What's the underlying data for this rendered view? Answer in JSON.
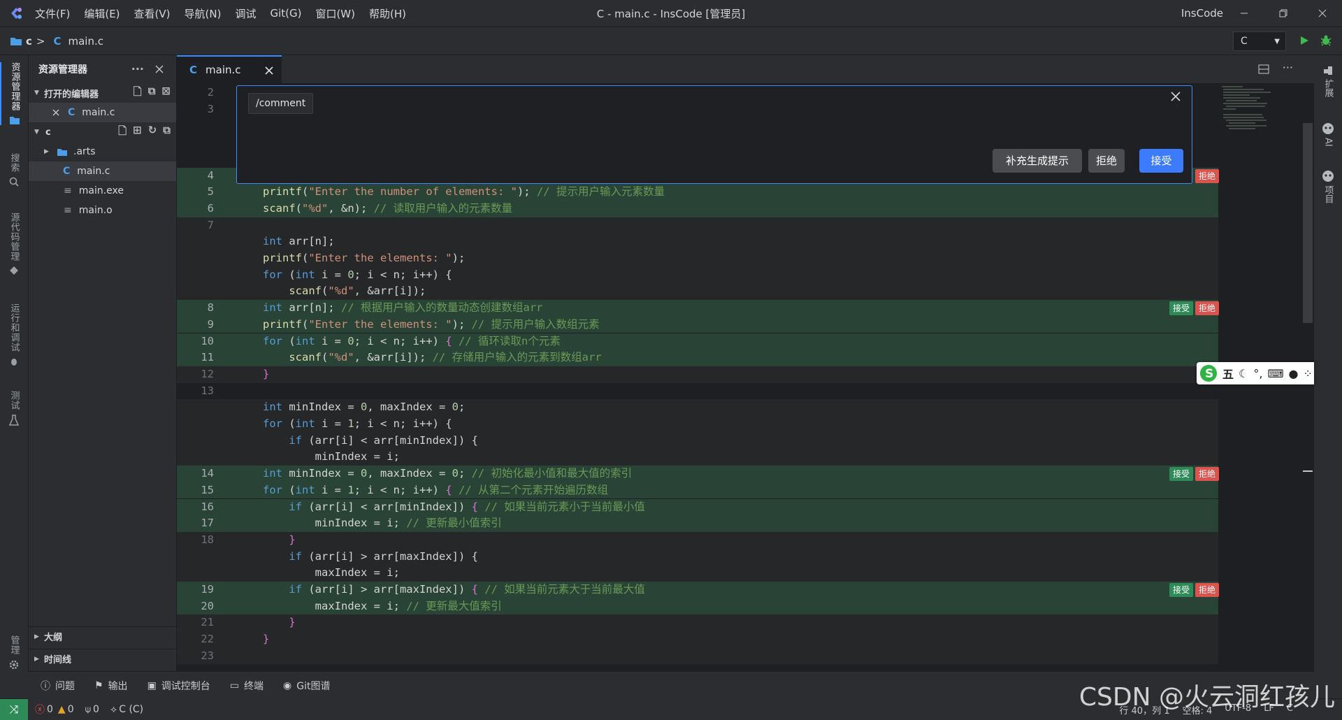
{
  "menu": [
    "文件(F)",
    "编辑(E)",
    "查看(V)",
    "导航(N)",
    "调试",
    "Git(G)",
    "窗口(W)",
    "帮助(H)"
  ],
  "window_title": "C - main.c - InsCode [管理员]",
  "brand": "InsCode",
  "breadcrumb": {
    "folder": "c",
    "sep": ">",
    "file_glyph": "C",
    "file": "main.c"
  },
  "language_select": "C",
  "activity_bar": [
    "资源管理器",
    "搜索",
    "源代码管理",
    "运行和调试",
    "测试",
    "管理"
  ],
  "right_bar": [
    "扩展",
    "AI",
    "项目"
  ],
  "explorer": {
    "title": "资源管理器",
    "open_editors": {
      "label": "打开的编辑器",
      "items": [
        {
          "glyph": "C",
          "name": "main.c"
        }
      ]
    },
    "folder": {
      "label": "c",
      "items": [
        {
          "name": ".arts",
          "type": "folder"
        },
        {
          "name": "main.c",
          "type": "c"
        },
        {
          "name": "main.exe",
          "type": "file"
        },
        {
          "name": "main.o",
          "type": "file"
        }
      ]
    },
    "outline": "大纲",
    "timeline": "时间线"
  },
  "tab": {
    "label": "main.c",
    "glyph": "C"
  },
  "popup": {
    "input": "/comment",
    "btn_supplement": "补充生成提示",
    "btn_reject": "拒绝",
    "btn_accept": "接受"
  },
  "diff_labels": {
    "accept": "接受",
    "reject": "拒绝"
  },
  "ime": {
    "mode": "五"
  },
  "panel_tabs": [
    "问题",
    "输出",
    "调试控制台",
    "终端",
    "Git图谱"
  ],
  "status": {
    "errors": "0",
    "warnings": "0",
    "ports": "0",
    "language": "C (C)",
    "position": "行 40，列 1",
    "spaces": "空格: 4",
    "encoding": "UTF-8",
    "eol": "LF",
    "lang_short": "C"
  },
  "watermark": "CSDN @火云洞红孩儿",
  "code_lines": [
    {
      "n": "2",
      "kind": "plain",
      "html": ""
    },
    {
      "n": "3",
      "kind": "plain",
      "html": ""
    },
    {
      "n": "",
      "kind": "plain",
      "html": ""
    },
    {
      "n": "",
      "kind": "plain",
      "html": ""
    },
    {
      "n": "",
      "kind": "plain",
      "html": ""
    },
    {
      "n": "4",
      "kind": "add",
      "html": "",
      "buttons": "reject"
    },
    {
      "n": "5",
      "kind": "add",
      "html": "<span class='fn'>printf</span><span class='pn'>(</span><span class='str'>\"Enter the number of elements: \"</span><span class='pn'>); </span><span class='cm'>// 提示用户输入元素数量</span>"
    },
    {
      "n": "6",
      "kind": "add",
      "html": "<span class='fn'>scanf</span><span class='pn'>(</span><span class='str'>\"%d\"</span><span class='pn'>, &amp;n); </span><span class='cm'>// 读取用户输入的元素数量</span>"
    },
    {
      "n": "7",
      "kind": "old",
      "html": ""
    },
    {
      "n": "",
      "kind": "old",
      "html": "<span class='kw'>int</span><span class='id'> arr[n];</span>"
    },
    {
      "n": "",
      "kind": "old",
      "html": "<span class='fn'>printf</span><span class='pn'>(</span><span class='str'>\"Enter the elements: \"</span><span class='pn'>);</span>"
    },
    {
      "n": "",
      "kind": "old",
      "html": "<span class='kw'>for</span><span class='pn'> (</span><span class='kw'>int</span><span class='id'> i = </span><span class='num'>0</span><span class='id'>; i &lt; n; i++) {</span>"
    },
    {
      "n": "",
      "kind": "old",
      "html": "    <span class='fn'>scanf</span><span class='pn'>(</span><span class='str'>\"%d\"</span><span class='pn'>, &amp;arr[i]);</span>"
    },
    {
      "n": "8",
      "kind": "add",
      "html": "<span class='kw'>int</span><span class='id'> arr[n]; </span><span class='cm'>// 根据用户输入的数量动态创建数组arr</span>",
      "buttons": "both"
    },
    {
      "n": "9",
      "kind": "add",
      "html": "<span class='fn'>printf</span><span class='pn'>(</span><span class='str'>\"Enter the elements: \"</span><span class='pn'>); </span><span class='cm'>// 提示用户输入数组元素</span>"
    },
    {
      "n": "10",
      "kind": "add",
      "html": "<span class='kw'>for</span><span class='pn'> (</span><span class='kw'>int</span><span class='id'> i = </span><span class='num'>0</span><span class='id'>; i &lt; n; i++) </span><span class='br'>{</span><span class='cm'> // 循环读取n个元素</span>"
    },
    {
      "n": "11",
      "kind": "add",
      "html": "    <span class='fn'>scanf</span><span class='pn'>(</span><span class='str'>\"%d\"</span><span class='pn'>, &amp;arr[i]); </span><span class='cm'>// 存储用户输入的元素到数组arr</span>"
    },
    {
      "n": "12",
      "kind": "old",
      "html": "<span class='br'>}</span>"
    },
    {
      "n": "13",
      "kind": "plain",
      "html": ""
    },
    {
      "n": "",
      "kind": "old",
      "html": "<span class='kw'>int</span><span class='id'> minIndex = </span><span class='num'>0</span><span class='id'>, maxIndex = </span><span class='num'>0</span><span class='id'>;</span>"
    },
    {
      "n": "",
      "kind": "old",
      "html": "<span class='kw'>for</span><span class='pn'> (</span><span class='kw'>int</span><span class='id'> i = </span><span class='num'>1</span><span class='id'>; i &lt; n; i++) {</span>"
    },
    {
      "n": "",
      "kind": "old",
      "html": "    <span class='kw'>if</span><span class='id'> (arr[i] &lt; arr[minIndex]) {</span>"
    },
    {
      "n": "",
      "kind": "old",
      "html": "        <span class='id'>minIndex = i;</span>"
    },
    {
      "n": "14",
      "kind": "add",
      "html": "<span class='kw'>int</span><span class='id'> minIndex = </span><span class='num'>0</span><span class='id'>, maxIndex = </span><span class='num'>0</span><span class='id'>; </span><span class='cm'>// 初始化最小值和最大值的索引</span>",
      "buttons": "both"
    },
    {
      "n": "15",
      "kind": "add",
      "html": "<span class='kw'>for</span><span class='pn'> (</span><span class='kw'>int</span><span class='id'> i = </span><span class='num'>1</span><span class='id'>; i &lt; n; i++) </span><span class='br'>{</span><span class='cm'> // 从第二个元素开始遍历数组</span>"
    },
    {
      "n": "16",
      "kind": "add",
      "html": "    <span class='kw'>if</span><span class='id'> (arr[i] &lt; arr[minIndex]) </span><span class='br'>{</span><span class='cm'> // 如果当前元素小于当前最小值</span>"
    },
    {
      "n": "17",
      "kind": "add",
      "html": "        <span class='id'>minIndex = i; </span><span class='cm'>// 更新最小值索引</span>"
    },
    {
      "n": "18",
      "kind": "old",
      "html": "    <span class='br'>}</span>"
    },
    {
      "n": "",
      "kind": "old",
      "html": "    <span class='kw'>if</span><span class='id'> (arr[i] &gt; arr[maxIndex]) {</span>"
    },
    {
      "n": "",
      "kind": "old",
      "html": "        <span class='id'>maxIndex = i;</span>"
    },
    {
      "n": "19",
      "kind": "add",
      "html": "    <span class='kw'>if</span><span class='id'> (arr[i] &gt; arr[maxIndex]) </span><span class='br'>{</span><span class='cm'> // 如果当前元素大于当前最大值</span>",
      "buttons": "both"
    },
    {
      "n": "20",
      "kind": "add",
      "html": "        <span class='id'>maxIndex = i; </span><span class='cm'>// 更新最大值索引</span>"
    },
    {
      "n": "21",
      "kind": "old",
      "html": "    <span class='br'>}</span>"
    },
    {
      "n": "22",
      "kind": "old",
      "html": "<span class='br'>}</span>"
    },
    {
      "n": "23",
      "kind": "old",
      "html": ""
    }
  ]
}
